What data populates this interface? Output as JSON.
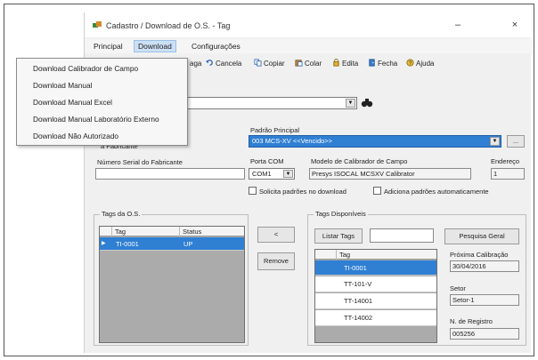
{
  "window": {
    "title": "Cadastro / Download de O.S. - Tag",
    "minimize": "–",
    "close": "×"
  },
  "menu": {
    "items": [
      "Principal",
      "Download",
      "Configurações"
    ],
    "open_menu": {
      "items": [
        "Download Calibrador de Campo",
        "Download Manual",
        "Download Manual Excel",
        "Download Manual Laboratório Externo",
        "Download Não Autorizado"
      ]
    }
  },
  "toolbar": {
    "partial_label": "aga",
    "cancel": "Cancela",
    "copy": "Copiar",
    "paste": "Colar",
    "edit": "Edita",
    "close": "Fecha",
    "help": "Ajuda"
  },
  "search": {
    "value": "",
    "binoculars_icon": "binoculars-icon"
  },
  "form": {
    "partial_field": "a Fabricante",
    "serial_label": "Número Serial do Fabricante",
    "serial_value": "",
    "padrao_label": "Padrão Principal",
    "padrao_value": "003 MCS-XV <<Vencido>>",
    "padrao_btn": "...",
    "porta_label": "Porta COM",
    "porta_value": "COM1",
    "modelo_label": "Modelo de Calibrador de Campo",
    "modelo_value": "Presys ISOCAL MCSXV Calibrator",
    "endereco_label": "Endereço",
    "endereco_value": "1",
    "solicita_label": "Solicita padrões no download",
    "adiciona_label": "Adiciona padrões automaticamente"
  },
  "tags_os": {
    "title": "Tags da O.S.",
    "columns": [
      "Tag",
      "Status"
    ],
    "rows": [
      {
        "tag": "TI-0001",
        "status": "UP"
      }
    ]
  },
  "buttons": {
    "move_left": "<",
    "remove": "Remove",
    "list_tags": "Listar Tags",
    "general_search": "Pesquisa Geral"
  },
  "tags_disp": {
    "title": "Tags Disponíveis",
    "filter": "",
    "columns": [
      "Tag"
    ],
    "rows": [
      "TI-0001",
      "TT-101-V",
      "TT-14001",
      "TT-14002"
    ]
  },
  "details": {
    "next_cal_label": "Próxima Calibração",
    "next_cal_value": "30/04/2016",
    "sector_label": "Setor",
    "sector_value": "Setor-1",
    "reg_label": "N. de Registro",
    "reg_value": "005256"
  },
  "colors": {
    "selection": "#2f7fd3",
    "menu_highlight": "#cce0f5"
  }
}
